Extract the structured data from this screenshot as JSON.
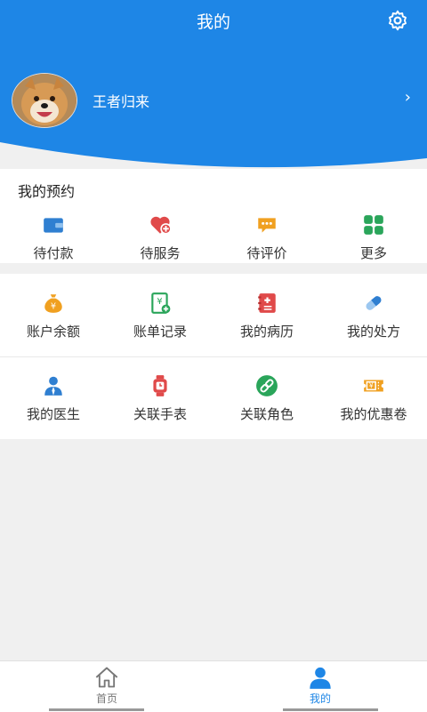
{
  "header": {
    "title": "我的",
    "username": "王者归来"
  },
  "appointments": {
    "title": "我的预约",
    "items": [
      {
        "label": "待付款",
        "icon": "wallet-icon",
        "color": "#2f7fd1"
      },
      {
        "label": "待服务",
        "icon": "heart-plus-icon",
        "color": "#e04a4a"
      },
      {
        "label": "待评价",
        "icon": "chat-bubble-icon",
        "color": "#f0a020"
      },
      {
        "label": "更多",
        "icon": "grid-icon",
        "color": "#2aa55a"
      }
    ]
  },
  "services": {
    "row1": [
      {
        "label": "账户余额",
        "icon": "money-bag-icon",
        "color": "#f0a020"
      },
      {
        "label": "账单记录",
        "icon": "bill-icon",
        "color": "#2aa55a"
      },
      {
        "label": "我的病历",
        "icon": "medical-record-icon",
        "color": "#e04a4a"
      },
      {
        "label": "我的处方",
        "icon": "pill-icon",
        "color": "#2f7fd1"
      }
    ],
    "row2": [
      {
        "label": "我的医生",
        "icon": "doctor-icon",
        "color": "#2f7fd1"
      },
      {
        "label": "关联手表",
        "icon": "watch-icon",
        "color": "#e04a4a"
      },
      {
        "label": "关联角色",
        "icon": "link-icon",
        "color": "#2aa55a"
      },
      {
        "label": "我的优惠卷",
        "icon": "coupon-icon",
        "color": "#f0a020"
      }
    ]
  },
  "tabbar": {
    "tabs": [
      {
        "label": "首页",
        "icon": "home-icon"
      },
      {
        "label": "我的",
        "icon": "user-icon"
      }
    ]
  },
  "colors": {
    "brand": "#1e86e6",
    "active_tab": "#1e86e6",
    "inactive_tab": "#777777"
  }
}
